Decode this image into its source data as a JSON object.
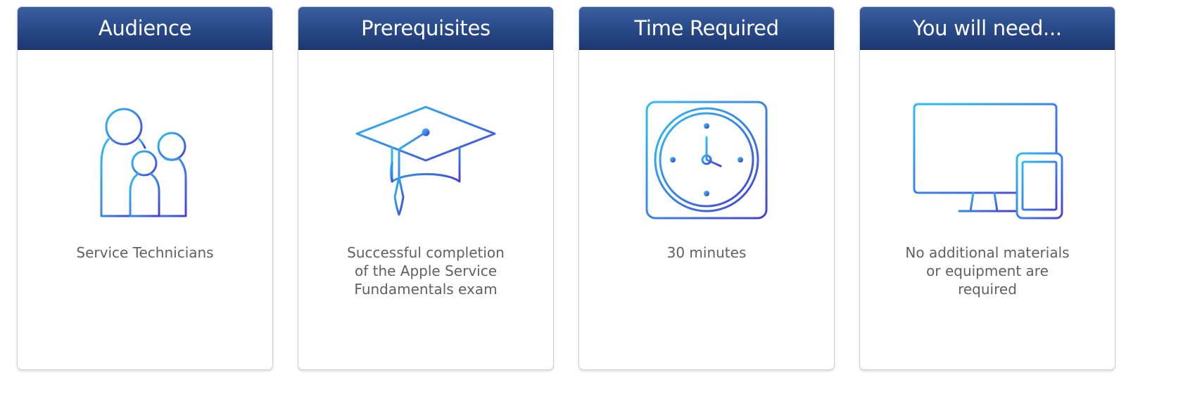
{
  "cards": [
    {
      "title": "Audience",
      "text": "Service Technicians",
      "icon": "people-icon"
    },
    {
      "title": "Prerequisites",
      "text": "Successful completion\nof the Apple Service\nFundamentals exam",
      "icon": "graduation-cap-icon"
    },
    {
      "title": "Time Required",
      "text": "30 minutes",
      "icon": "clock-icon"
    },
    {
      "title": "You will need...",
      "text": "No additional materials\nor equipment are\nrequired",
      "icon": "computer-tablet-icon"
    }
  ],
  "colors": {
    "header_top": "#3b5fa0",
    "header_bottom": "#1d3770",
    "icon_gradient_start": "#2fbdf5",
    "icon_gradient_end": "#4a3fcf",
    "body_text": "#5f5f64"
  }
}
